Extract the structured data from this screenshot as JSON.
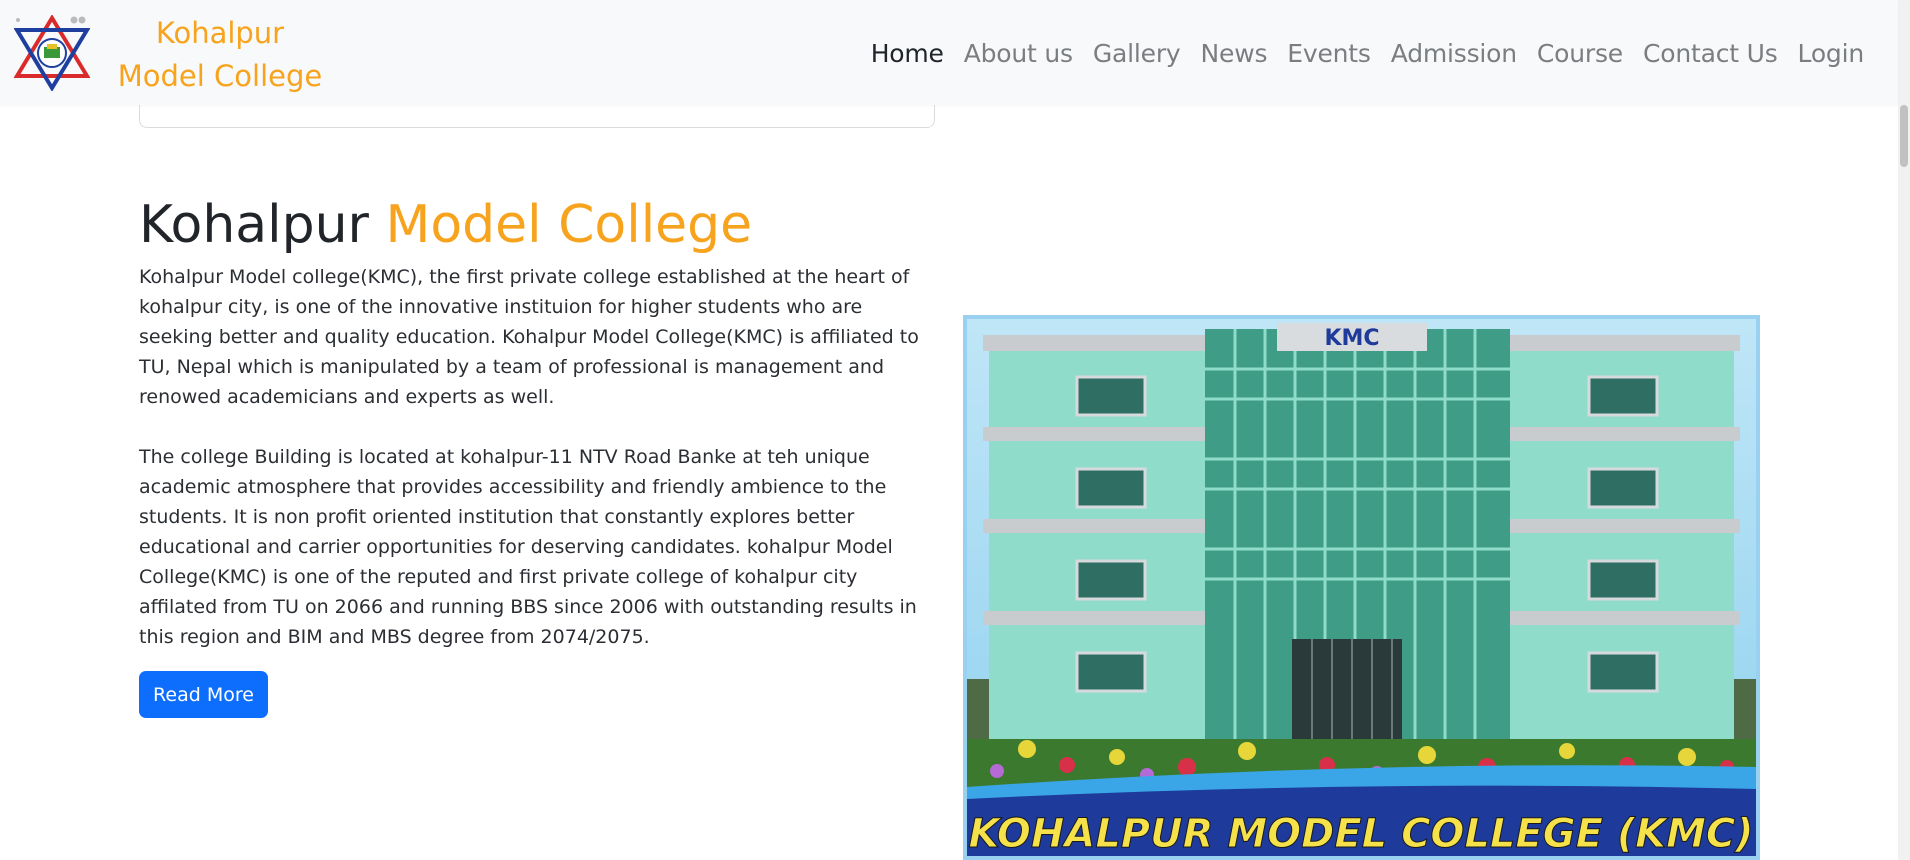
{
  "navbar": {
    "brand": "Kohalpur Model College",
    "logo_icon": "college-emblem-icon",
    "links": [
      {
        "label": "Home",
        "active": true
      },
      {
        "label": "About us"
      },
      {
        "label": "Gallery"
      },
      {
        "label": "News"
      },
      {
        "label": "Events"
      },
      {
        "label": "Admission"
      },
      {
        "label": "Course"
      },
      {
        "label": "Contact Us"
      },
      {
        "label": "Login"
      }
    ]
  },
  "main": {
    "heading_dark": "Kohalpur",
    "heading_accent": "Model College",
    "paragraph1": "Kohalpur Model college(KMC), the first private college established at the heart of kohalpur city, is one of the innovative instituion for higher students who are seeking better and quality education. Kohalpur Model College(KMC) is affiliated to TU, Nepal which is manipulated by a team of professional is management and renowed academicians and experts as well.",
    "paragraph2": "The college Building is located at kohalpur-11 NTV Road Banke at teh unique academic atmosphere that provides accessibility and friendly ambience to the students. It is non profit oriented institution that constantly explores better educational and carrier opportunities for deserving candidates. kohalpur Model College(KMC) is one of the reputed and first private college of kohalpur city affilated from TU on 2066 and running BBS since 2006 with outstanding results in this region and BIM and MBS degree from 2074/2075.",
    "read_more": "Read More"
  },
  "photo": {
    "sign_text": "KMC",
    "banner_text": "KOHALPUR MODEL COLLEGE (KMC)"
  },
  "colors": {
    "accent": "#f7a31d",
    "primary_button": "#0d6efd",
    "building": "#7fd6c6",
    "banner": "#1e3a9a"
  }
}
